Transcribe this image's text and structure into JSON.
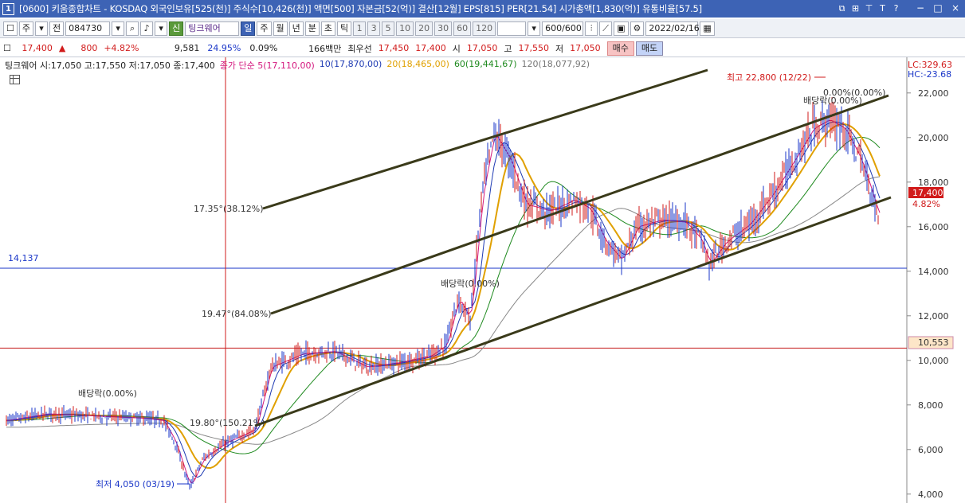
{
  "titlebar": {
    "window_number": "1",
    "title": "[0600] 키움종합차트 - KOSDAQ 외국인보유[525(천)] 주식수[10,426(천)] 액면[500] 자본금[52(억)] 결산[12월] EPS[815] PER[21.54] 시가총액[1,830(억)] 유통비율[57.5]",
    "icons": [
      "restore-icon",
      "grid-icon",
      "pin-icon",
      "text-icon",
      "help-icon"
    ],
    "icon_glyphs": [
      "⧉",
      "⊞",
      "⊤",
      "T",
      "?"
    ],
    "controls": [
      "−",
      "□",
      "×"
    ]
  },
  "toolbar": {
    "period_short": "주",
    "prev_label": "전",
    "stock_code": "084730",
    "stock_badge": "신",
    "stock_name": "팅크웨어",
    "periods": [
      "일",
      "주",
      "월",
      "년",
      "분",
      "초",
      "틱"
    ],
    "selected_period": "일",
    "intervals": [
      "1",
      "3",
      "5",
      "10",
      "20",
      "30",
      "60",
      "120"
    ],
    "count": "600/600",
    "date": "2022/02/16"
  },
  "quote": {
    "price": "17,400",
    "change_arrow": "▲",
    "change": "800",
    "change_pct": "+4.82%",
    "volume": "9,581",
    "turnover_pct": "24.95%",
    "rate": "0.09%",
    "amount": "166백만",
    "best_ask_label": "최우선",
    "best_ask": "17,450",
    "best_bid": "17,400",
    "open_label": "시",
    "open": "17,050",
    "high_label": "고",
    "high": "17,550",
    "low_label": "저",
    "low": "17,050",
    "buy_label": "매수",
    "sell_label": "매도"
  },
  "chart": {
    "legend": {
      "candle": "팅크웨어 시:17,050 고:17,550 저:17,050 종:17,400",
      "ma5": "종가 단순 5(17,110,00)",
      "ma10": "10(17,870,00)",
      "ma20": "20(18,465,00)",
      "ma60": "60(19,441,67)",
      "ma120": "120(18,077,92)"
    },
    "colors": {
      "ma5": "#d4187e",
      "ma10": "#1f3bb3",
      "ma20": "#e0a000",
      "ma60": "#1f8a1f",
      "ma120": "#888888",
      "up_candle": "#d11b1b",
      "down_candle": "#1a36c8",
      "trendline": "#3a3a1a"
    },
    "y_axis": {
      "min": 3600,
      "max": 23600,
      "ticks": [
        "22,000",
        "20,000",
        "18,000",
        "16,000",
        "14,000",
        "12,000",
        "10,000",
        "8,000",
        "6,000",
        "4,000"
      ]
    },
    "lc_label": "LC:329.63",
    "hc_label": "HC:-23.68",
    "current_price_label": "17,400",
    "current_pct_label": "4.82%",
    "blue_hline_label": "14,137",
    "blue_hline_value": 14137,
    "red_hline_label": "10,553",
    "red_hline_value": 10553,
    "annotations": {
      "high": "최고 22,800 (12/22)",
      "low": "최저 4,050 (03/19)",
      "dividend_1": "배당락(0.00%)",
      "dividend_2": "배당락(0.00%)",
      "dividend_3": "배당락(0.00%)",
      "dividend_4": "0.00%(0.00%)",
      "angle_1": "17.35°(38.12%)",
      "angle_2": "19.47°(84.08%)",
      "angle_3": "19.80°(150.21%)"
    }
  }
}
